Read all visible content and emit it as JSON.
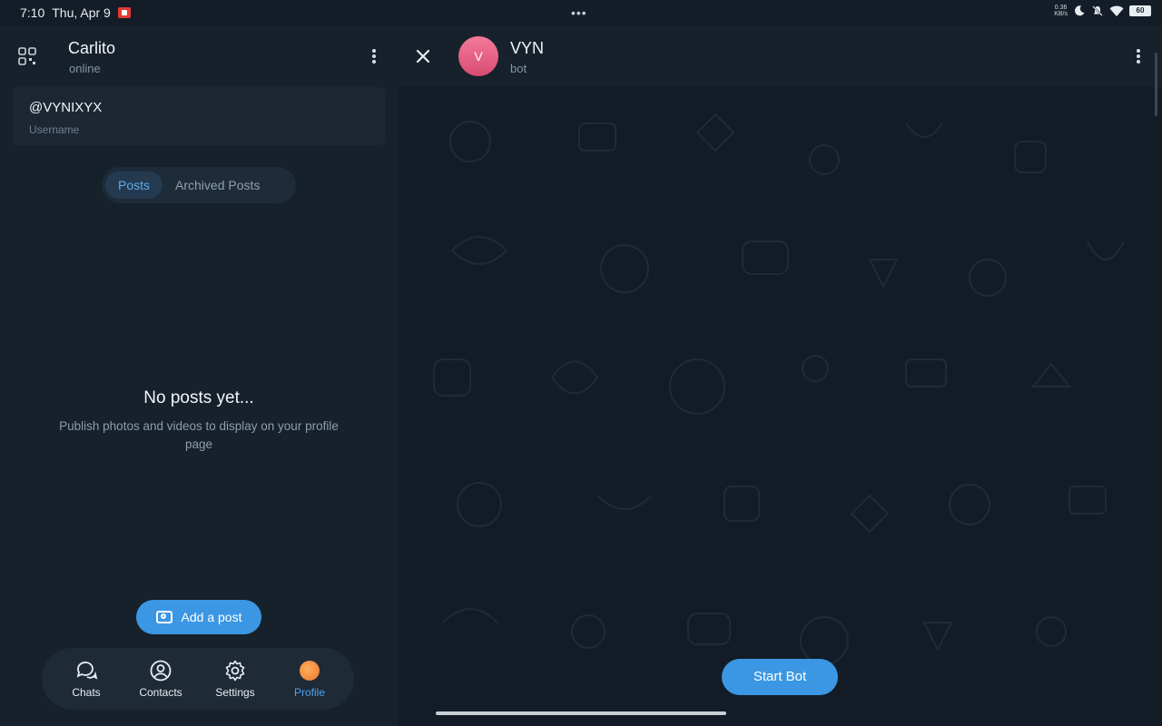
{
  "status_bar": {
    "time": "7:10",
    "date": "Thu, Apr 9",
    "dots": "•••",
    "net_speed_value": "0.36",
    "net_speed_unit": "KB/s",
    "battery": "60"
  },
  "left_panel": {
    "profile_name": "Carlito",
    "profile_status": "online",
    "username_value": "@VYNIXYX",
    "username_label": "Username",
    "tabs": [
      {
        "label": "Posts",
        "active": true
      },
      {
        "label": "Archived Posts",
        "active": false
      }
    ],
    "empty_title": "No posts yet...",
    "empty_desc": "Publish photos and videos to display on your profile page",
    "add_post_label": "Add a post",
    "nav": [
      {
        "label": "Chats",
        "icon": "chat-bubbles-icon",
        "active": false
      },
      {
        "label": "Contacts",
        "icon": "person-circle-icon",
        "active": false
      },
      {
        "label": "Settings",
        "icon": "gear-icon",
        "active": false
      },
      {
        "label": "Profile",
        "icon": "profile-avatar-icon",
        "active": true
      }
    ]
  },
  "right_panel": {
    "bot_avatar_letter": "V",
    "bot_name": "VYN",
    "bot_status": "bot",
    "start_bot_label": "Start Bot"
  },
  "colors": {
    "accent": "#3b97e3",
    "left_bg": "#17212b",
    "chat_bg": "#131c26",
    "avatar_pink": "#e45a80"
  }
}
